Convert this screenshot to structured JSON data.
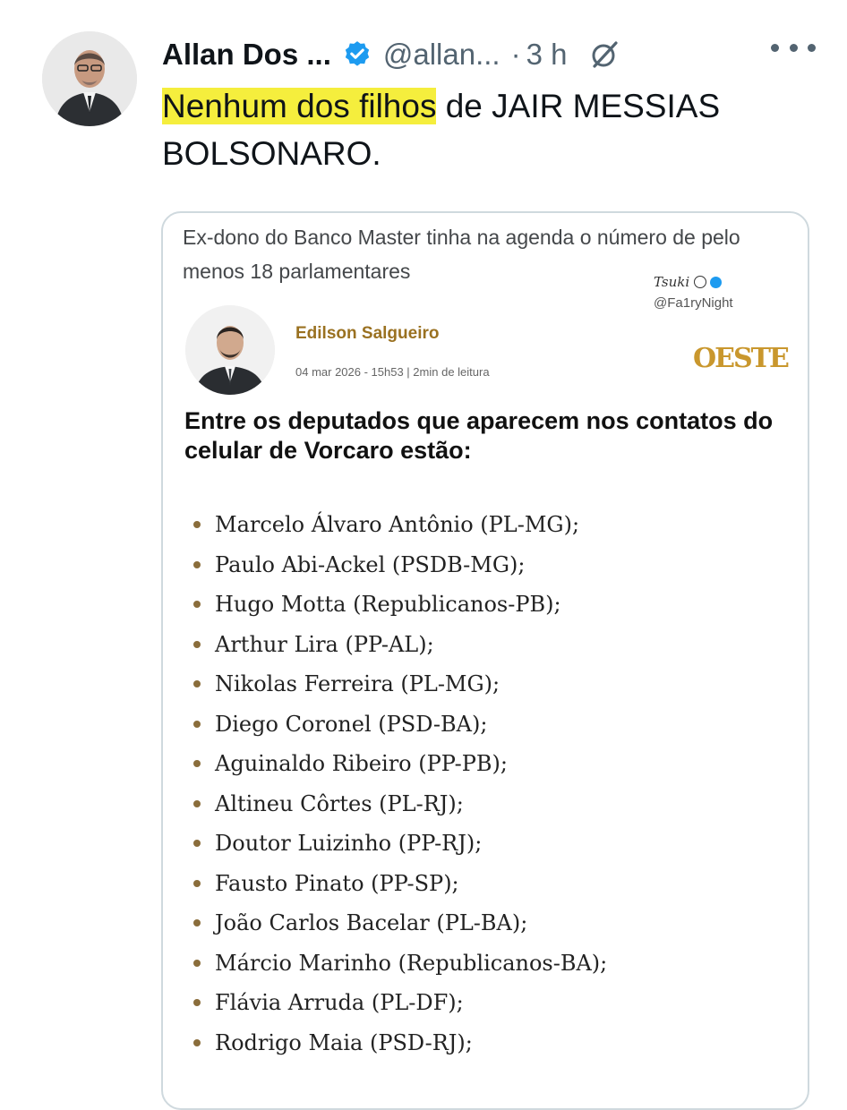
{
  "author": {
    "name": "Allan Dos ...",
    "handle": "@allan...",
    "separator": "·",
    "time": "3 h"
  },
  "tweet": {
    "highlighted_text": "Nenhum dos filhos",
    "text_rest": " de JAIR MESSIAS BOLSONARO."
  },
  "card": {
    "headline": "Ex-dono do Banco Master tinha na agenda o número de pelo menos 18 parlamentares",
    "watermark_name": "Tsuki",
    "watermark_handle": "@Fa1ryNight",
    "article_author": "Edilson Salgueiro",
    "publisher_logo": "OESTE",
    "meta": "04 mar 2026 - 15h53 | 2min de leitura",
    "subheading": "Entre os deputados que aparecem nos contatos do celular de Vorcaro estão:",
    "deputies": [
      "Marcelo Álvaro Antônio (PL-MG);",
      "Paulo Abi-Ackel (PSDB-MG);",
      "Hugo Motta (Republicanos-PB);",
      "Arthur Lira (PP-AL);",
      "Nikolas Ferreira (PL-MG);",
      "Diego Coronel (PSD-BA);",
      "Aguinaldo Ribeiro (PP-PB);",
      "Altineu Côrtes (PL-RJ);",
      "Doutor Luizinho (PP-RJ);",
      "Fausto Pinato (PP-SP);",
      "João Carlos Bacelar (PL-BA);",
      "Márcio Marinho (Republicanos-BA);",
      "Flávia Arruda (PL-DF);",
      "Rodrigo Maia (PSD-RJ);"
    ]
  },
  "icons": {
    "verified": "verified-badge-icon",
    "grok": "grok-icon",
    "more": "more-options-icon"
  },
  "colors": {
    "highlight": "#f5ee3d",
    "verified": "#1d9bf0",
    "oeste_gold": "#c9972d",
    "author_gold": "#9a7121"
  }
}
